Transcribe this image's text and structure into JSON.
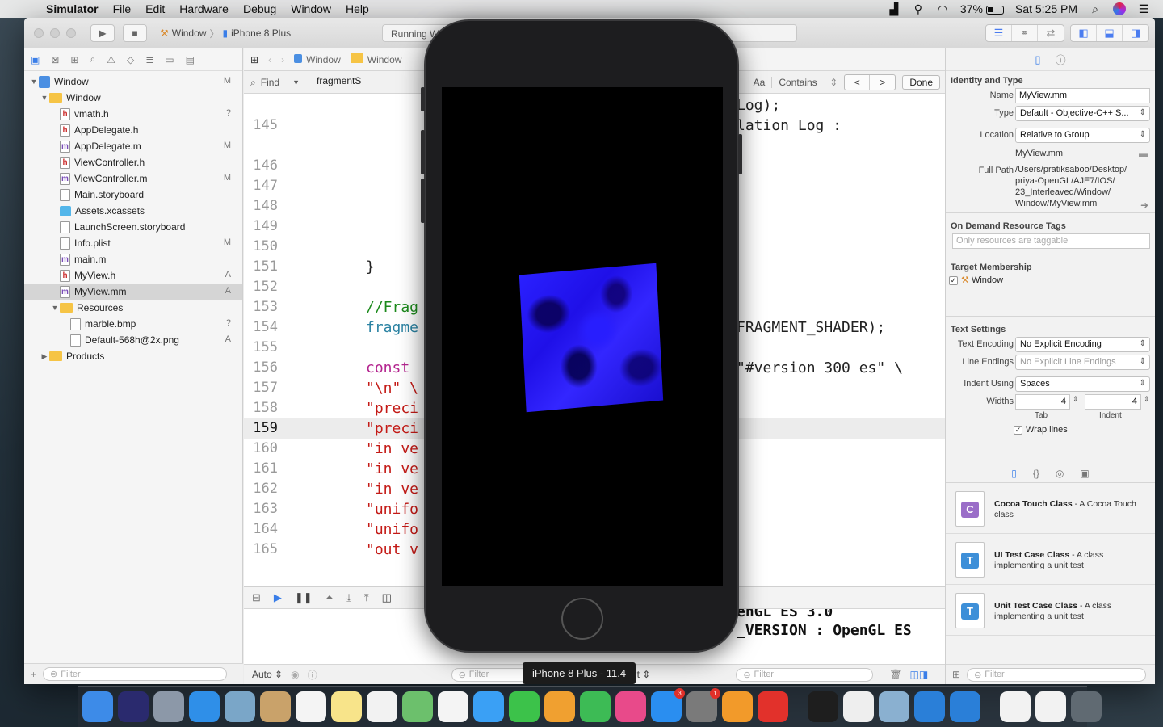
{
  "menubar": {
    "app_name": "Simulator",
    "items": [
      "File",
      "Edit",
      "Hardware",
      "Debug",
      "Window",
      "Help"
    ],
    "battery": "37%",
    "clock": "Sat 5:25 PM"
  },
  "xcode": {
    "scheme": {
      "target": "Window",
      "device": "iPhone 8 Plus"
    },
    "activity": "Running W",
    "jumpbar": [
      "Window",
      "Window"
    ],
    "find": {
      "mode": "Find",
      "query": "fragmentS",
      "case_label": "Aa",
      "match_mode": "Contains",
      "done_label": "Done"
    },
    "navigator": {
      "rows": [
        {
          "name": "Window",
          "type": "project",
          "status": "M",
          "level": 0,
          "disc": "▼"
        },
        {
          "name": "Window",
          "type": "folder",
          "status": "",
          "level": 1,
          "disc": "▼"
        },
        {
          "name": "vmath.h",
          "type": "h",
          "status": "?",
          "level": 2,
          "disc": ""
        },
        {
          "name": "AppDelegate.h",
          "type": "h",
          "status": "",
          "level": 2,
          "disc": ""
        },
        {
          "name": "AppDelegate.m",
          "type": "m",
          "status": "M",
          "level": 2,
          "disc": ""
        },
        {
          "name": "ViewController.h",
          "type": "h",
          "status": "",
          "level": 2,
          "disc": ""
        },
        {
          "name": "ViewController.m",
          "type": "m",
          "status": "M",
          "level": 2,
          "disc": ""
        },
        {
          "name": "Main.storyboard",
          "type": "sb",
          "status": "",
          "level": 2,
          "disc": ""
        },
        {
          "name": "Assets.xcassets",
          "type": "xc",
          "status": "",
          "level": 2,
          "disc": ""
        },
        {
          "name": "LaunchScreen.storyboard",
          "type": "sb",
          "status": "",
          "level": 2,
          "disc": ""
        },
        {
          "name": "Info.plist",
          "type": "pl",
          "status": "M",
          "level": 2,
          "disc": ""
        },
        {
          "name": "main.m",
          "type": "m",
          "status": "",
          "level": 2,
          "disc": ""
        },
        {
          "name": "MyView.h",
          "type": "h",
          "status": "A",
          "level": 2,
          "disc": ""
        },
        {
          "name": "MyView.mm",
          "type": "m",
          "status": "A",
          "level": 2,
          "disc": "",
          "selected": true
        },
        {
          "name": "Resources",
          "type": "folder",
          "status": "",
          "level": 2,
          "disc": "▼"
        },
        {
          "name": "marble.bmp",
          "type": "pl",
          "status": "?",
          "level": 3,
          "disc": ""
        },
        {
          "name": "Default-568h@2x.png",
          "type": "pl",
          "status": "A",
          "level": 3,
          "disc": ""
        },
        {
          "name": "Products",
          "type": "folder",
          "status": "",
          "level": 1,
          "disc": "▶"
        }
      ],
      "filter_placeholder": "Filter"
    },
    "code": {
      "current_line": "159",
      "lines": [
        {
          "n": "",
          "t": "",
          "r": "Log);"
        },
        {
          "n": "145",
          "t": "",
          "r": "lation Log :"
        },
        {
          "n": "",
          "t": "",
          "r": ""
        },
        {
          "n": "146",
          "t": "",
          "r": ""
        },
        {
          "n": "147",
          "t": "",
          "r": ""
        },
        {
          "n": "148",
          "t": "",
          "r": ""
        },
        {
          "n": "149",
          "t": "",
          "r": ""
        },
        {
          "n": "150",
          "t": "        }",
          "r": ""
        },
        {
          "n": "151",
          "t": "}",
          "r": ""
        },
        {
          "n": "152",
          "t": "",
          "r": ""
        },
        {
          "n": "153",
          "t": "//Frag",
          "r": ""
        },
        {
          "n": "154",
          "t": "fragme",
          "r": "FRAGMENT_SHADER);"
        },
        {
          "n": "155",
          "t": "",
          "r": ""
        },
        {
          "n": "156",
          "t": "const ",
          "r": "\"#version 300 es\" \\"
        },
        {
          "n": "157",
          "t": "\"\\n\" \\",
          "r": ""
        },
        {
          "n": "158",
          "t": "\"preci",
          "r": ""
        },
        {
          "n": "159",
          "t": "\"preci",
          "r": ""
        },
        {
          "n": "160",
          "t": "\"in ve",
          "r": ""
        },
        {
          "n": "161",
          "t": "\"in ve",
          "r": ""
        },
        {
          "n": "162",
          "t": "\"in ve",
          "r": ""
        },
        {
          "n": "163",
          "t": "\"unifo",
          "r": ""
        },
        {
          "n": "164",
          "t": "\"unifo",
          "r": ""
        },
        {
          "n": "165",
          "t": "\"out v",
          "r": ""
        }
      ]
    },
    "console": {
      "line1": "enGL ES 3.0",
      "line2": "_VERSION : OpenGL ES"
    },
    "bottombar": {
      "auto_label": "Auto",
      "filter_left": "Filter",
      "filter_right": "Filter",
      "output_label": "t"
    },
    "inspector": {
      "identity_title": "Identity and Type",
      "name_label": "Name",
      "name_value": "MyView.mm",
      "type_label": "Type",
      "type_value": "Default - Objective-C++ S...",
      "location_label": "Location",
      "location_value": "Relative to Group",
      "location_file": "MyView.mm",
      "fullpath_label": "Full Path",
      "fullpath_value": "/Users/pratiksaboo/Desktop/ priya-OpenGL/AJE7/IOS/ 23_Interleaved/Window/ Window/MyView.mm",
      "ondemand_title": "On Demand Resource Tags",
      "tags_placeholder": "Only resources are taggable",
      "target_title": "Target Membership",
      "target_name": "Window",
      "text_title": "Text Settings",
      "encoding_label": "Text Encoding",
      "encoding_value": "No Explicit Encoding",
      "endings_label": "Line Endings",
      "endings_value": "No Explicit Line Endings",
      "indent_label": "Indent Using",
      "indent_value": "Spaces",
      "widths_label": "Widths",
      "tab_value": "4",
      "indent_width_value": "4",
      "tab_caption": "Tab",
      "indent_caption": "Indent",
      "wrap_label": "Wrap lines",
      "library": [
        {
          "title": "Cocoa Touch Class",
          "desc": " - A Cocoa Touch class",
          "letter": "C",
          "color": "#9a6dc8"
        },
        {
          "title": "UI Test Case Class",
          "desc": " - A class implementing a unit test",
          "letter": "T",
          "color": "#3d8fd8"
        },
        {
          "title": "Unit Test Case Class",
          "desc": " - A class implementing a unit test",
          "letter": "T",
          "color": "#3d8fd8"
        }
      ],
      "library_filter": "Filter"
    }
  },
  "simulator": {
    "device_tooltip": "iPhone 8 Plus - 11.4"
  },
  "dock": {
    "apps": [
      {
        "name": "Finder",
        "color": "#3d8be8"
      },
      {
        "name": "Siri",
        "color": "#2a2a6e"
      },
      {
        "name": "Launchpad",
        "color": "#8c98a8"
      },
      {
        "name": "Safari",
        "color": "#2f8fe8"
      },
      {
        "name": "Preview",
        "color": "#7aa6c8"
      },
      {
        "name": "Contacts",
        "color": "#c9a26a"
      },
      {
        "name": "Calendar",
        "color": "#f4f4f4"
      },
      {
        "name": "Notes",
        "color": "#f8e48a"
      },
      {
        "name": "Reminders",
        "color": "#f2f2f2"
      },
      {
        "name": "Maps",
        "color": "#6cc06c"
      },
      {
        "name": "Photos",
        "color": "#f4f4f4"
      },
      {
        "name": "Messages",
        "color": "#3aa0f5"
      },
      {
        "name": "FaceTime",
        "color": "#3cc24a"
      },
      {
        "name": "Pages",
        "color": "#f0a030"
      },
      {
        "name": "Numbers",
        "color": "#3dbb55"
      },
      {
        "name": "iTunes",
        "color": "#e84a8a"
      },
      {
        "name": "App Store",
        "color": "#2a8ef0",
        "badge": "3"
      },
      {
        "name": "System Preferences",
        "color": "#7a7a7a",
        "badge": "1"
      },
      {
        "name": "iBooks",
        "color": "#f29a2a"
      },
      {
        "name": "AnyDesk",
        "color": "#e2312b"
      },
      {
        "name": "Terminal",
        "color": "#1e1e1e"
      },
      {
        "name": "TextEdit",
        "color": "#eeeeee"
      },
      {
        "name": "Image Capture",
        "color": "#8ab0d0"
      },
      {
        "name": "Xcode",
        "color": "#2a7fd8"
      },
      {
        "name": "Simulator",
        "color": "#2a7fd8"
      },
      {
        "name": "Document",
        "color": "#f2f2f2"
      },
      {
        "name": "Document 2",
        "color": "#f2f2f2"
      },
      {
        "name": "Trash",
        "color": "#606a72"
      }
    ]
  }
}
